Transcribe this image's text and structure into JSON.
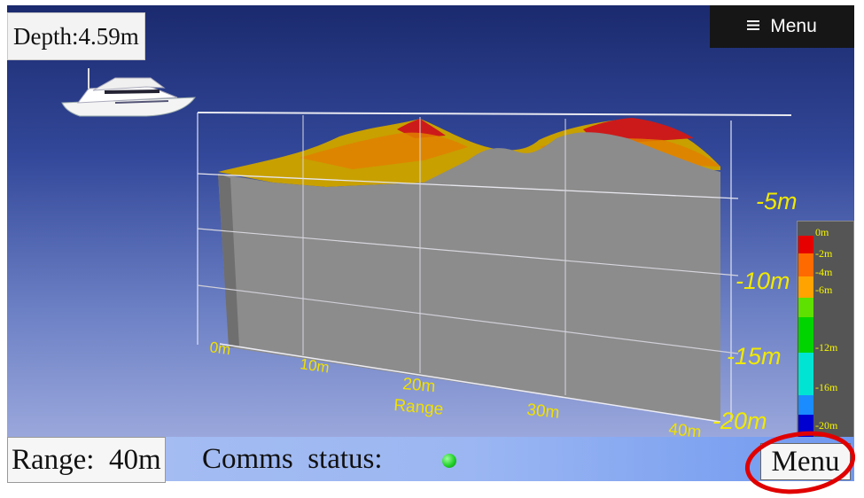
{
  "depth": {
    "text": "Depth:4.59m"
  },
  "menu_top": {
    "label": "Menu",
    "icon": "hamburger-icon"
  },
  "scene": {
    "boat_icon": "yacht-icon",
    "range_ticks": [
      "0m",
      "10m",
      "20m",
      "30m",
      "40m"
    ],
    "range_label": "Range",
    "depth_ticks": [
      "-5m",
      "-10m",
      "-15m",
      "-20m"
    ],
    "surface_color": "#8c8c8c",
    "terrain_colors": [
      "#c8a000",
      "#e08000",
      "#d43a00",
      "#cc1a1a"
    ]
  },
  "legend": {
    "labels": [
      "0m",
      "-2m",
      "-4m",
      "-6m",
      "-12m",
      "-16m",
      "-20m"
    ],
    "colors": [
      "#e60000",
      "#ff6a00",
      "#ffa300",
      "#5ee000",
      "#00d400",
      "#00e4d4",
      "#1a8cff",
      "#0000d0"
    ]
  },
  "status_bar": {
    "range_text": "Range:  40m",
    "comms_text": "Comms  status:",
    "status_color": "#22d22a",
    "menu_label": "Menu",
    "highlight_color": "#e00000"
  }
}
